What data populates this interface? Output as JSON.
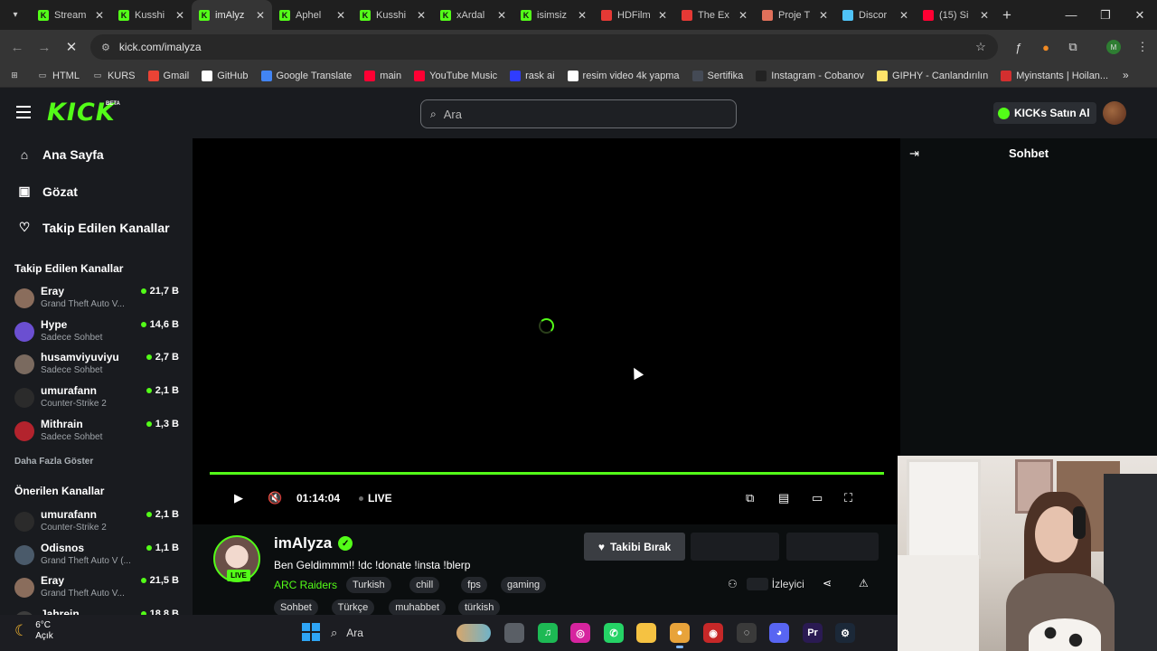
{
  "browser": {
    "tabs": [
      {
        "label": "Stream",
        "favicon": "kick-favicon",
        "color": "#53fc18",
        "active": false
      },
      {
        "label": "Kusshi",
        "favicon": "kick-favicon",
        "color": "#53fc18",
        "active": false
      },
      {
        "label": "imAlyz",
        "favicon": "kick-favicon",
        "color": "#53fc18",
        "active": true
      },
      {
        "label": "Aphel",
        "favicon": "kick-favicon",
        "color": "#53fc18",
        "active": false
      },
      {
        "label": "Kusshi",
        "favicon": "kick-favicon",
        "color": "#53fc18",
        "active": false
      },
      {
        "label": "xArdal",
        "favicon": "kick-favicon",
        "color": "#53fc18",
        "active": false
      },
      {
        "label": "isimsiz",
        "favicon": "kick-favicon",
        "color": "#53fc18",
        "active": false
      },
      {
        "label": "HDFilm",
        "favicon": "play-favicon",
        "color": "#e53935",
        "active": false
      },
      {
        "label": "The Ex",
        "favicon": "play-favicon",
        "color": "#e53935",
        "active": false
      },
      {
        "label": "Proje T",
        "favicon": "pen-favicon",
        "color": "#e0705a",
        "active": false
      },
      {
        "label": "Discor",
        "favicon": "globe-favicon",
        "color": "#4fc3f7",
        "active": false
      },
      {
        "label": "(15) Si",
        "favicon": "youtube-favicon",
        "color": "#ff0033",
        "active": false
      }
    ],
    "url": "kick.com/imalyza",
    "bookmarks": [
      {
        "label": "",
        "icon": "apps-grid-icon",
        "color": "#cfcfcf"
      },
      {
        "label": "HTML",
        "icon": "folder-icon",
        "color": "#cfcfcf"
      },
      {
        "label": "KURS",
        "icon": "folder-icon",
        "color": "#cfcfcf"
      },
      {
        "label": "Gmail",
        "icon": "gmail-icon",
        "color": "#ea4335"
      },
      {
        "label": "GitHub",
        "icon": "github-icon",
        "color": "#ffffff"
      },
      {
        "label": "Google Translate",
        "icon": "translate-icon",
        "color": "#4285f4"
      },
      {
        "label": "main",
        "icon": "youtube-icon",
        "color": "#ff0033"
      },
      {
        "label": "YouTube Music",
        "icon": "youtube-music-icon",
        "color": "#ff0033"
      },
      {
        "label": "rask ai",
        "icon": "rask-icon",
        "color": "#2f3cff"
      },
      {
        "label": "resim video 4k yapma",
        "icon": "capcut-icon",
        "color": "#ffffff"
      },
      {
        "label": "Sertifika",
        "icon": "page-icon",
        "color": "#444a55"
      },
      {
        "label": "Instagram - Cobanov",
        "icon": "instagram-icon",
        "color": "#222222"
      },
      {
        "label": "GIPHY - Canlandırılın",
        "icon": "giphy-icon",
        "color": "#ffe36a"
      },
      {
        "label": "Myinstants | Hoilan...",
        "icon": "myinstants-icon",
        "color": "#d32f2f"
      }
    ]
  },
  "kick": {
    "logo": "KICK",
    "beta": "BETA",
    "search_placeholder": "Ara",
    "buy_kicks": "KICKs Satın Al",
    "accent": "#53fc18",
    "nav": [
      {
        "label": "Ana Sayfa",
        "icon": "home-icon"
      },
      {
        "label": "Gözat",
        "icon": "browse-icon"
      },
      {
        "label": "Takip Edilen Kanallar",
        "icon": "heart-icon"
      }
    ],
    "followed_heading": "Takip Edilen Kanallar",
    "followed": [
      {
        "name": "Eray",
        "game": "Grand Theft Auto V...",
        "viewers": "21,7 B",
        "avatar": "#8a6d5c"
      },
      {
        "name": "Hype",
        "game": "Sadece Sohbet",
        "viewers": "14,6 B",
        "avatar": "#6b4fd1"
      },
      {
        "name": "husamviyuviyu",
        "game": "Sadece Sohbet",
        "viewers": "2,7 B",
        "avatar": "#7a6a5f"
      },
      {
        "name": "umurafann",
        "game": "Counter-Strike 2",
        "viewers": "2,1 B",
        "avatar": "#2b2b2b"
      },
      {
        "name": "Mithrain",
        "game": "Sadece Sohbet",
        "viewers": "1,3 B",
        "avatar": "#b3232d"
      }
    ],
    "show_more": "Daha Fazla Göster",
    "recommended_heading": "Önerilen Kanallar",
    "recommended": [
      {
        "name": "umurafann",
        "game": "Counter-Strike 2",
        "viewers": "2,1 B",
        "avatar": "#2b2b2b"
      },
      {
        "name": "Odisnos",
        "game": "Grand Theft Auto V (...",
        "viewers": "1,1 B",
        "avatar": "#4a5a6a"
      },
      {
        "name": "Eray",
        "game": "Grand Theft Auto V...",
        "viewers": "21,5 B",
        "avatar": "#8a6d5c"
      },
      {
        "name": "Jahrein",
        "game": "",
        "viewers": "18,8 B",
        "avatar": "#3d3d3d"
      }
    ],
    "player": {
      "time": "01:14:04",
      "live": "LIVE",
      "progress": 1.0
    },
    "channel": {
      "name": "imAlyza",
      "live_badge": "LIVE",
      "stream_title": "Ben Geldimmm!! !dc !donate !insta !blerp",
      "category": "ARC Raiders",
      "tags_row1": [
        "Turkish",
        "chill",
        "fps",
        "gaming"
      ],
      "tags_row2": [
        "Sohbet",
        "Türkçe",
        "muhabbet",
        "türkish"
      ],
      "unfollow": "Takibi Bırak",
      "viewers_label": "İzleyici"
    },
    "chat": {
      "title": "Sohbet"
    }
  },
  "taskbar": {
    "temp": "6°C",
    "weather": "Açık",
    "search": "Ara",
    "apps": [
      {
        "name": "file-manager",
        "icon": "window-icon",
        "color": "#5a5f66",
        "label": ""
      },
      {
        "name": "spotify",
        "icon": "spotify-icon",
        "color": "#1db954",
        "label": "♫"
      },
      {
        "name": "instagram",
        "icon": "instagram-icon",
        "color": "#d6249f",
        "label": "◎"
      },
      {
        "name": "whatsapp",
        "icon": "whatsapp-icon",
        "color": "#25d366",
        "label": "✆"
      },
      {
        "name": "explorer",
        "icon": "folder-icon",
        "color": "#f5c242",
        "label": ""
      },
      {
        "name": "chrome",
        "icon": "chrome-icon",
        "color": "#e8a33a",
        "label": "●"
      },
      {
        "name": "app-red",
        "icon": "record-icon",
        "color": "#c62828",
        "label": "◉"
      },
      {
        "name": "obs",
        "icon": "obs-icon",
        "color": "#3a3a3a",
        "label": "◌"
      },
      {
        "name": "discord",
        "icon": "discord-icon",
        "color": "#5865f2",
        "label": "◕"
      },
      {
        "name": "premiere",
        "icon": "premiere-icon",
        "color": "#2a1a52",
        "label": "Pr"
      },
      {
        "name": "steam",
        "icon": "steam-icon",
        "color": "#1b2838",
        "label": "⚙"
      }
    ]
  }
}
